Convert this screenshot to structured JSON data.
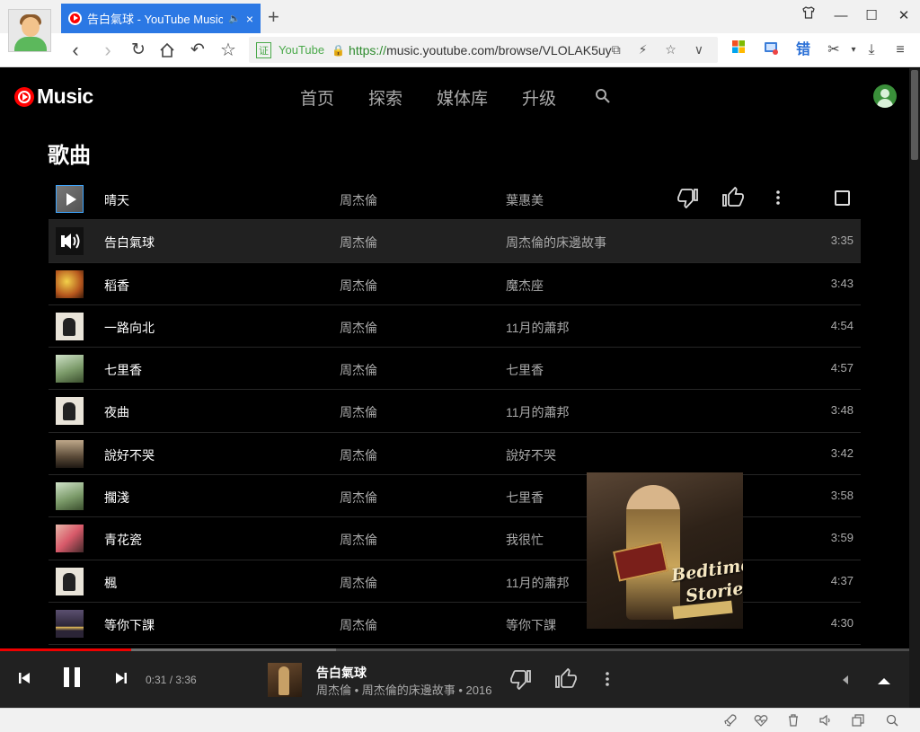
{
  "browser": {
    "tab_title": "告白氣球 - YouTube Music",
    "tab_mute": "🔈",
    "tab_close": "×",
    "new_tab": "+",
    "url_site_badge": "证",
    "url_site_name": "YouTube",
    "url_scheme": "https://",
    "url_rest": "music.youtube.com/browse/VLOLAK5uy",
    "url_icons": "⧉ ⚡ ☆ ∨"
  },
  "app": {
    "logo_text": "Music",
    "nav": [
      "首页",
      "探索",
      "媒体库",
      "升级"
    ],
    "section_title": "歌曲"
  },
  "songs": [
    {
      "title": "晴天",
      "artist": "周杰倫",
      "album": "葉惠美",
      "duration": ""
    },
    {
      "title": "告白氣球",
      "artist": "周杰倫",
      "album": "周杰倫的床邊故事",
      "duration": "3:35"
    },
    {
      "title": "稻香",
      "artist": "周杰倫",
      "album": "魔杰座",
      "duration": "3:43"
    },
    {
      "title": "一路向北",
      "artist": "周杰倫",
      "album": "11月的蕭邦",
      "duration": "4:54"
    },
    {
      "title": "七里香",
      "artist": "周杰倫",
      "album": "七里香",
      "duration": "4:57"
    },
    {
      "title": "夜曲",
      "artist": "周杰倫",
      "album": "11月的蕭邦",
      "duration": "3:48"
    },
    {
      "title": "說好不哭",
      "artist": "周杰倫",
      "album": "說好不哭",
      "duration": "3:42"
    },
    {
      "title": "擱淺",
      "artist": "周杰倫",
      "album": "七里香",
      "duration": "3:58"
    },
    {
      "title": "青花瓷",
      "artist": "周杰倫",
      "album": "我很忙",
      "duration": "3:59"
    },
    {
      "title": "楓",
      "artist": "周杰倫",
      "album": "11月的蕭邦",
      "duration": "4:37"
    },
    {
      "title": "等你下課",
      "artist": "周杰倫",
      "album": "等你下課",
      "duration": "4:30"
    }
  ],
  "album_art_text": {
    "line1": "Bedtime",
    "line2": "Stories"
  },
  "player": {
    "time": "0:31 / 3:36",
    "title": "告白氣球",
    "subtitle": "周杰倫 • 周杰倫的床邊故事 • 2016",
    "progress_fraction": 0.144,
    "buffer_fraction": 0.37
  },
  "colors": {
    "accent": "#ff0000",
    "tab_active": "#2b78e4",
    "secure": "#4aa94a"
  }
}
